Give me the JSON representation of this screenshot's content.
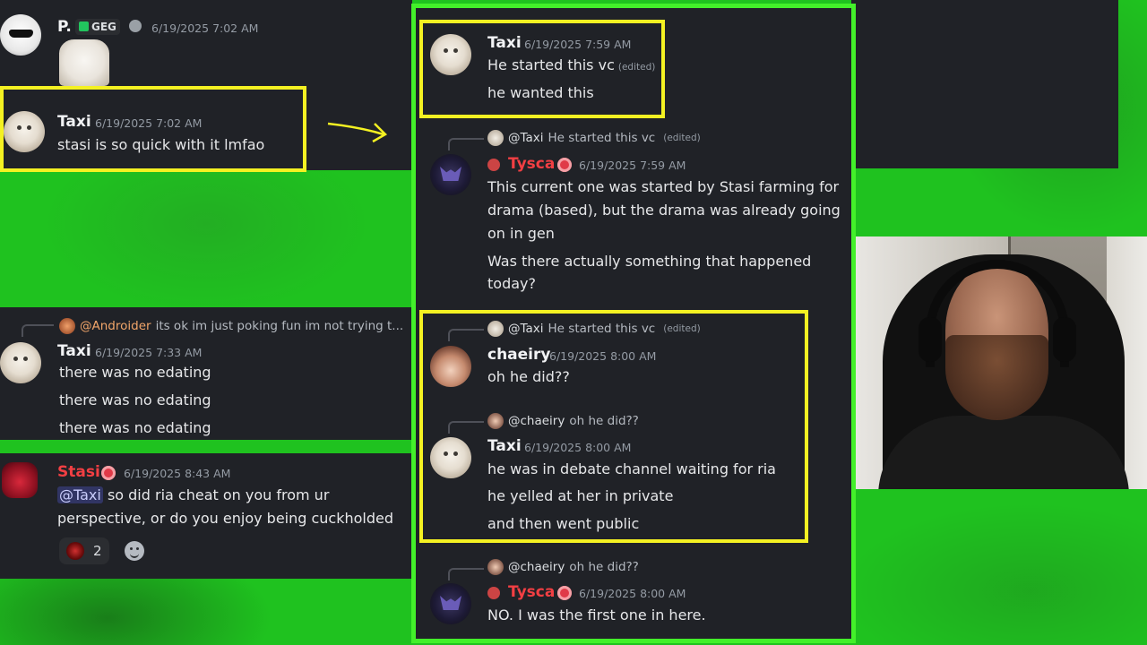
{
  "colors": {
    "chroma_green": "#1fc21f",
    "panel_bg": "#202227",
    "highlight_yellow": "#f4f122",
    "highlight_green": "#43f02a",
    "role_red": "#f23f43"
  },
  "icons": [
    "sunglasses-avatar",
    "cat-avatar",
    "bat-avatar",
    "girl-avatar",
    "devil-avatar",
    "role-icon",
    "add-reaction-icon",
    "arrow-icon"
  ],
  "left": {
    "top_msg": {
      "name": "P.",
      "badge": "GEG",
      "timestamp": "6/19/2025 7:02 AM"
    },
    "taxi_msg": {
      "name": "Taxi",
      "timestamp": "6/19/2025 7:02 AM",
      "text": "stasi is so quick with it lmfao"
    },
    "edating": {
      "reply_handle": "@Androider",
      "reply_text": "its ok im just poking fun im not trying t...",
      "name": "Taxi",
      "timestamp": "6/19/2025 7:33 AM",
      "lines": [
        "there was no edating",
        "there was no edating",
        "there was no edating"
      ]
    },
    "stasi": {
      "name": "Stasi",
      "timestamp": "6/19/2025 8:43 AM",
      "mention": "@Taxi",
      "line1": "so did ria cheat on you from ur",
      "line2": "perspective, or do you enjoy being cuckholded",
      "reaction_count": "2"
    }
  },
  "center": {
    "m1": {
      "name": "Taxi",
      "timestamp": "6/19/2025 7:59 AM",
      "line1": "He started this vc",
      "edited": "(edited)",
      "line2": "he wanted this"
    },
    "m2": {
      "reply_handle": "@Taxi",
      "reply_text": "He started this vc",
      "reply_edited": "(edited)",
      "name": "Tysca",
      "timestamp": "6/19/2025 7:59 AM",
      "lines": [
        "This current one was started by Stasi farming for",
        "drama (based), but the drama was already going",
        "on in gen",
        "Was there actually something that happened",
        "today?"
      ]
    },
    "m3": {
      "reply_handle": "@Taxi",
      "reply_text": "He started this vc",
      "reply_edited": "(edited)",
      "name": "chaeiry",
      "timestamp": "6/19/2025 8:00 AM",
      "text": "oh he did??"
    },
    "m4": {
      "reply_handle": "@chaeiry",
      "reply_text": "oh he did??",
      "name": "Taxi",
      "timestamp": "6/19/2025 8:00 AM",
      "lines": [
        "he was in debate channel waiting for ria",
        "he yelled at her in private",
        "and then went public"
      ]
    },
    "m5": {
      "reply_handle": "@chaeiry",
      "reply_text": "oh he did??",
      "name": "Tysca",
      "timestamp": "6/19/2025 8:00 AM",
      "text": "NO. I was the first one in here."
    }
  }
}
